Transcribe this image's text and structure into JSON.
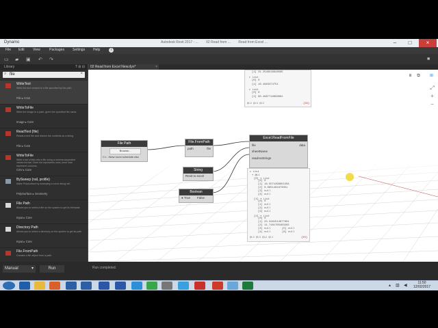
{
  "window": {
    "title": "Dynamo",
    "title_mid": [
      "Autodesk Revit 2017 - ...",
      "02 Read from ...",
      "Read from Excel ..."
    ]
  },
  "menu": [
    "File",
    "Edit",
    "View",
    "Packages",
    "Settings",
    "Help"
  ],
  "library": {
    "header": "Library",
    "header_controls": "T  ⊞  ⊟",
    "search_value": "file",
    "results": [
      {
        "name": "WriteText",
        "desc": "Write the text content to a file specified by the path",
        "category": "File ▸ Core",
        "icon": "doc-write-icon"
      },
      {
        "name": "WriteToFile",
        "desc": "Write the image to a path, given the specified file name.",
        "category": "Image ▸ Core",
        "icon": "image-write-icon"
      },
      {
        "name": "ReadText (file)",
        "desc": "Reads a text file and returns the contents as a string.",
        "category": "File ▸ Core",
        "icon": "read-text-icon"
      },
      {
        "name": "WriteToFile",
        "desc": "Write a list of lists into a file using a comma-separated values format. Outer list represents rows, inner lists represent columns.",
        "category": "CSV ▸ Core",
        "icon": "csv-write-icon"
      },
      {
        "name": "BySweep (rail, profile)",
        "desc": "Make Polysurface by sweeping a curve along rail.",
        "category": "PolySurface ▸ Geometry",
        "icon": "sweep-icon"
      },
      {
        "name": "File Path",
        "desc": "Allows you to select a file on the system to get its filename",
        "category": "Input ▸ Core",
        "icon": "file-path-icon"
      },
      {
        "name": "Directory Path",
        "desc": "Allows you to select a directory on the system to get its path",
        "category": "Input ▸ Core",
        "icon": "directory-path-icon"
      },
      {
        "name": "File.FromPath",
        "desc": "Creates a file object from a path.",
        "category": "File ▸ Core",
        "icon": "file-from-path-icon"
      }
    ]
  },
  "tab": {
    "label": "02 Read from Excel New.dyn*",
    "close": "×"
  },
  "nodes": {
    "file_path": {
      "title": "File Path",
      "button": "Browse...",
      "value": "C:\\...\\New room schedule.xlsx"
    },
    "file_from_path": {
      "title": "File.FromPath",
      "in": "path",
      "out": "file"
    },
    "string": {
      "title": "String",
      "value": "Revit to excel"
    },
    "boolean": {
      "title": "Boolean",
      "true_label": "True",
      "false_label": "False"
    },
    "excel": {
      "title": "Excel.ReadFromFile",
      "in": [
        "file",
        "sheetName",
        "readAsStrings"
      ],
      "out": "data"
    }
  },
  "watch_top": {
    "rows": [
      "[1] 31.2548516948585",
      "▸ List",
      "[0] 0",
      "[1] 16.4963374751",
      "▸ List",
      "[0] 0",
      "[1] 60.4987716698081"
    ],
    "footer_left": "@L4 @L3 @L2",
    "footer_right": "{38}"
  },
  "watch_bottom": {
    "rows": [
      "▸ List",
      "▾ @L1",
      "[0] ▾ List",
      "[0] 0",
      "[1] 18.5574398651558",
      "[2] 0.0851481873051",
      "[3] null",
      "[4] null",
      "[1] ▾ List",
      "[0] 0",
      "[1] null",
      "[2] null",
      "[3] null",
      "[2] ▾ List",
      "[0] 0",
      "[1] 23.3181514677801",
      "[2] 11.7181765483283",
      "[3] null",
      "[4] null",
      "[5] null",
      "[6] null"
    ],
    "footer_left": "@L4 @L3 @L2 @L1",
    "footer_right": "{40}"
  },
  "bottom": {
    "mode": "Manual",
    "run": "Run",
    "status": "Run completed."
  },
  "clock": {
    "time": "11:50",
    "date": "12/02/2017"
  },
  "colors": {
    "accent_red": "#b5362b",
    "node_header": "#3c3c3c",
    "canvas": "#ffffff",
    "taskbar": "#ccd8e6"
  }
}
